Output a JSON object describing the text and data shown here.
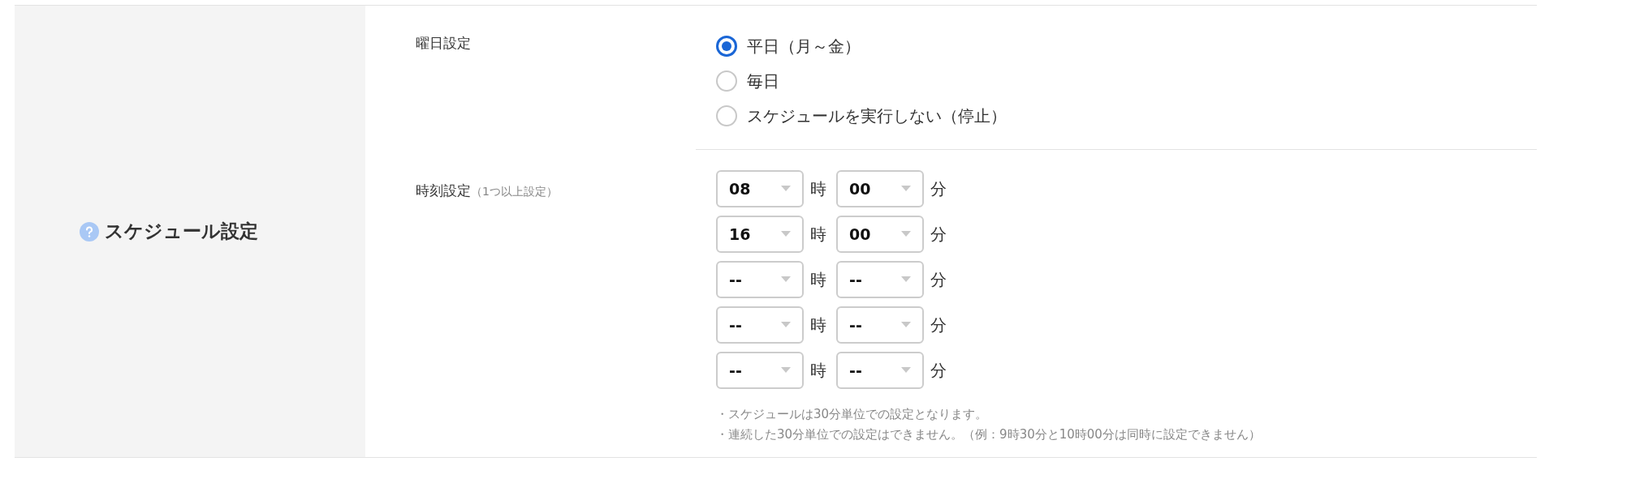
{
  "section": {
    "label": "スケジュール設定"
  },
  "weekday": {
    "label": "曜日設定",
    "options": [
      {
        "label": "平日（月～金）",
        "selected": true
      },
      {
        "label": "毎日",
        "selected": false
      },
      {
        "label": "スケジュールを実行しない（停止）",
        "selected": false
      }
    ]
  },
  "time": {
    "label": "時刻設定",
    "hint": "（1つ以上設定）",
    "rows": [
      {
        "hour": "08",
        "hour_unit": "時",
        "minute": "00",
        "minute_unit": "分"
      },
      {
        "hour": "16",
        "hour_unit": "時",
        "minute": "00",
        "minute_unit": "分"
      },
      {
        "hour": "--",
        "hour_unit": "時",
        "minute": "--",
        "minute_unit": "分"
      },
      {
        "hour": "--",
        "hour_unit": "時",
        "minute": "--",
        "minute_unit": "分"
      },
      {
        "hour": "--",
        "hour_unit": "時",
        "minute": "--",
        "minute_unit": "分"
      }
    ],
    "notes": [
      "・スケジュールは30分単位での設定となります。",
      "・連続した30分単位での設定はできません。（例：9時30分と10時00分は同時に設定できません）"
    ]
  }
}
